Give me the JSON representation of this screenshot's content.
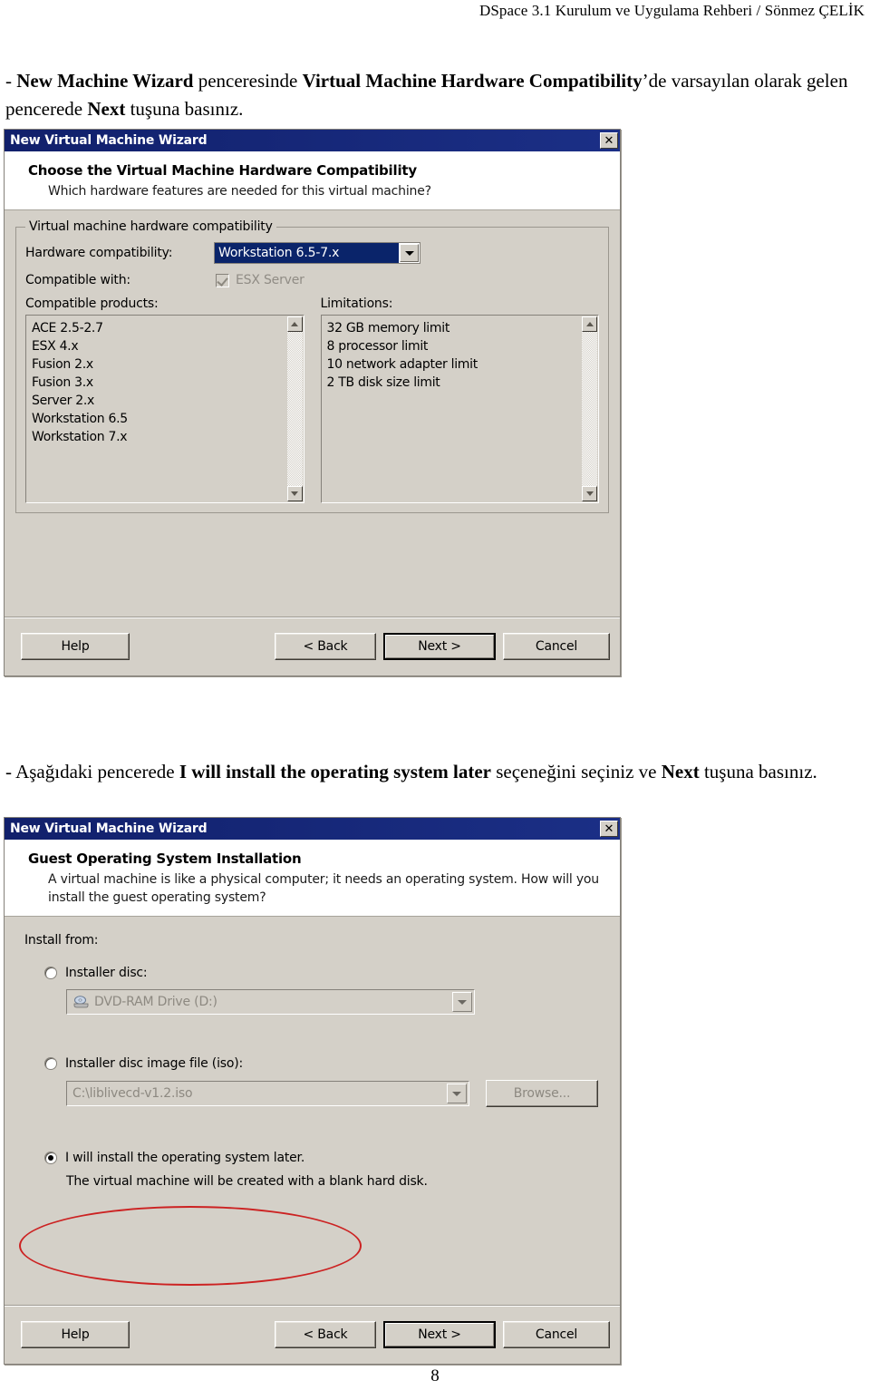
{
  "page": {
    "header": "DSpace 3.1  Kurulum ve Uygulama Rehberi / Sönmez ÇELİK",
    "number": "8",
    "paragraph1_pre": "- ",
    "paragraph1_b1": "New Machine Wizard",
    "paragraph1_mid": " penceresinde ",
    "paragraph1_b2": "Virtual Machine Hardware Compatibility",
    "paragraph1_mid2": "’de varsayılan olarak gelen pencerede ",
    "paragraph1_b3": "Next",
    "paragraph1_end": " tuşuna basınız.",
    "paragraph2_pre": "- Aşağıdaki pencerede ",
    "paragraph2_b1": "I will install the operating system later",
    "paragraph2_mid": " seçeneğini seçiniz ve ",
    "paragraph2_b2": "Next",
    "paragraph2_end": " tuşuna basınız."
  },
  "colors": {
    "titlebar": "#16226e",
    "dialog_face": "#d4d0c8",
    "selection": "#0a246a",
    "annotation_red": "#cc2222"
  },
  "dialog1": {
    "title": "New Virtual Machine Wizard",
    "close_label": "✕",
    "header_title": "Choose the Virtual Machine Hardware Compatibility",
    "header_sub": "Which hardware features are needed for this virtual machine?",
    "groupbox_title": "Virtual machine hardware compatibility",
    "hardware_compat_label": "Hardware compatibility:",
    "hardware_compat_value": "Workstation 6.5-7.x",
    "compatible_with_label": "Compatible with:",
    "esx_checkbox_label": "ESX Server",
    "esx_checkbox_checked": true,
    "compatible_products_label": "Compatible products:",
    "compatible_products": [
      "ACE 2.5-2.7",
      "ESX 4.x",
      "Fusion 2.x",
      "Fusion 3.x",
      "Server 2.x",
      "Workstation 6.5",
      "Workstation 7.x"
    ],
    "limitations_label": "Limitations:",
    "limitations": [
      "32 GB memory limit",
      "8 processor limit",
      "10 network adapter limit",
      "2 TB disk size limit"
    ],
    "buttons": {
      "help": "Help",
      "back": "< Back",
      "next": "Next >",
      "cancel": "Cancel"
    }
  },
  "dialog2": {
    "title": "New Virtual Machine Wizard",
    "close_label": "✕",
    "header_title": "Guest Operating System Installation",
    "header_sub": "A virtual machine is like a physical computer; it needs an operating system. How will you install the guest operating system?",
    "install_from_label": "Install from:",
    "option_installer_disc": "Installer disc:",
    "installer_disc_value": "DVD-RAM Drive (D:)",
    "option_iso": "Installer disc image file (iso):",
    "iso_value": "C:\\liblivecd-v1.2.iso",
    "browse_label": "Browse...",
    "option_later": "I will install the operating system later.",
    "option_later_sub": "The virtual machine will be created with a blank hard disk.",
    "selected_option": "later",
    "buttons": {
      "help": "Help",
      "back": "< Back",
      "next": "Next >",
      "cancel": "Cancel"
    }
  }
}
